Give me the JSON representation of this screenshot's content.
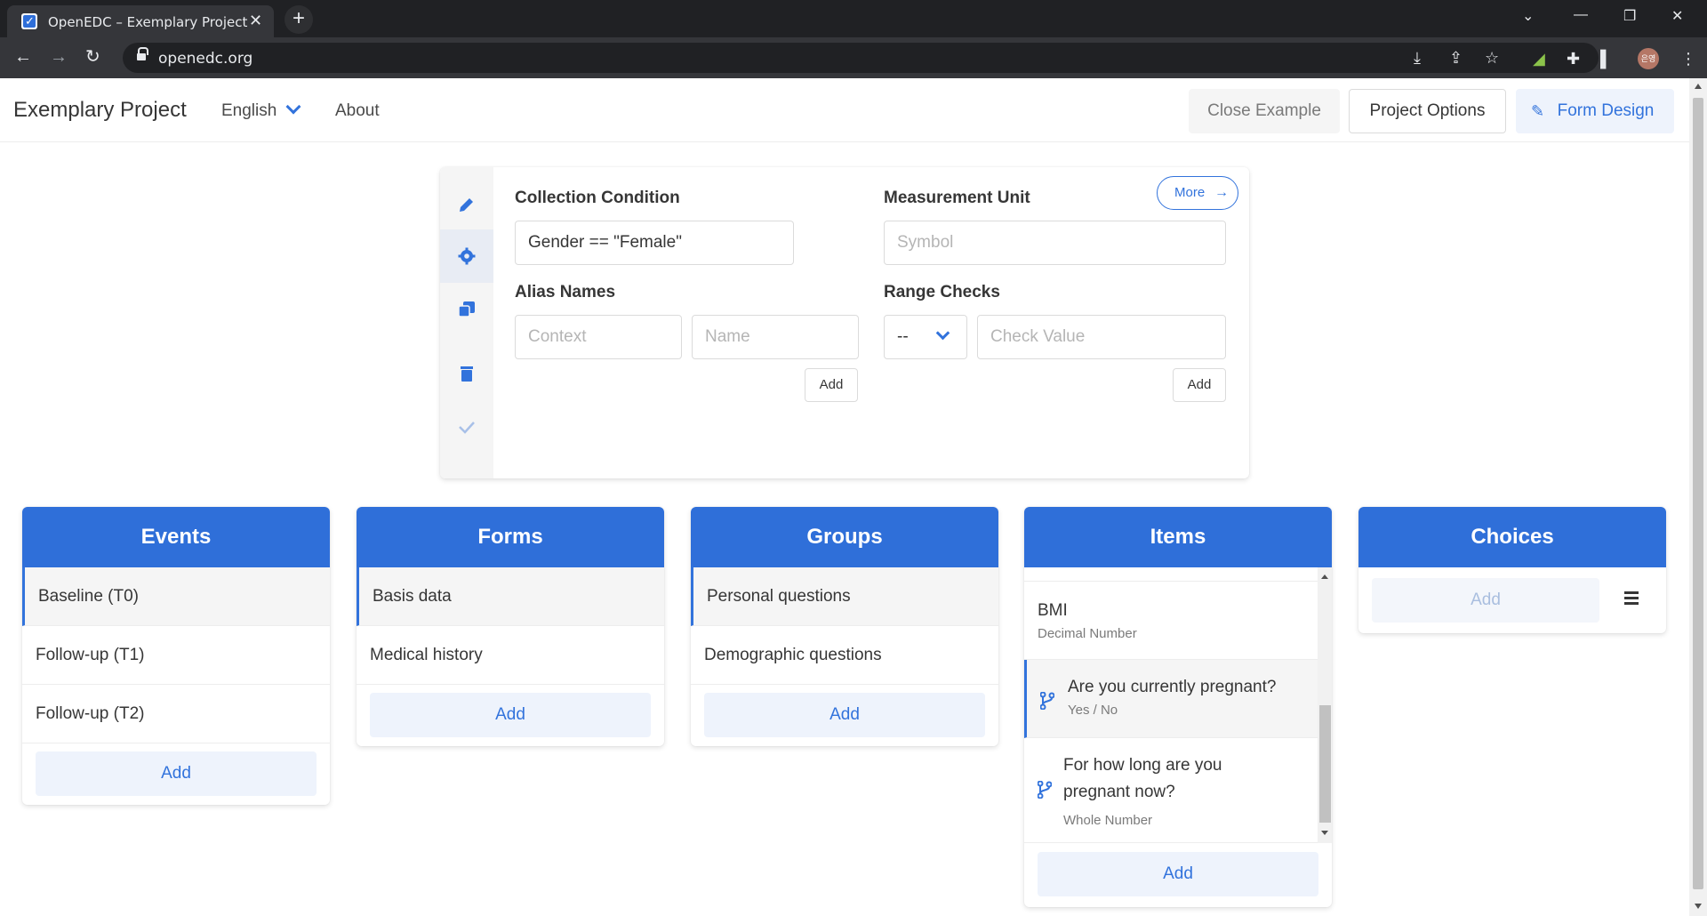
{
  "browser": {
    "tab_title": "OpenEDC – Exemplary Project",
    "url": "openedc.org",
    "profile_initials": "은영"
  },
  "navbar": {
    "brand": "Exemplary Project",
    "language": "English",
    "about": "About",
    "close_example": "Close Example",
    "project_options": "Project Options",
    "form_design": "Form Design"
  },
  "options": {
    "collection_condition_label": "Collection Condition",
    "collection_condition_value": "Gender == \"Female\"",
    "measurement_unit_label": "Measurement Unit",
    "measurement_unit_placeholder": "Symbol",
    "more_label": "More",
    "alias_names_label": "Alias Names",
    "alias_context_placeholder": "Context",
    "alias_name_placeholder": "Name",
    "alias_add": "Add",
    "range_checks_label": "Range Checks",
    "range_comparator": "--",
    "range_value_placeholder": "Check Value",
    "range_add": "Add"
  },
  "columns": {
    "events": {
      "title": "Events",
      "items": [
        "Baseline (T0)",
        "Follow-up (T1)",
        "Follow-up (T2)"
      ],
      "add": "Add"
    },
    "forms": {
      "title": "Forms",
      "items": [
        "Basis data",
        "Medical history"
      ],
      "add": "Add"
    },
    "groups": {
      "title": "Groups",
      "items": [
        "Personal questions",
        "Demographic questions"
      ],
      "add": "Add"
    },
    "items": {
      "title": "Items",
      "entries": [
        {
          "name": "BMI",
          "type": "Decimal Number"
        },
        {
          "name": "Are you currently pregnant?",
          "type": "Yes / No"
        },
        {
          "name": "For how long are you pregnant now?",
          "type": "Whole Number"
        }
      ],
      "add": "Add"
    },
    "choices": {
      "title": "Choices",
      "add": "Add"
    }
  },
  "colors": {
    "primary": "#2f6fd9",
    "link": "#3273dc",
    "light_bg": "#eef3fc"
  }
}
